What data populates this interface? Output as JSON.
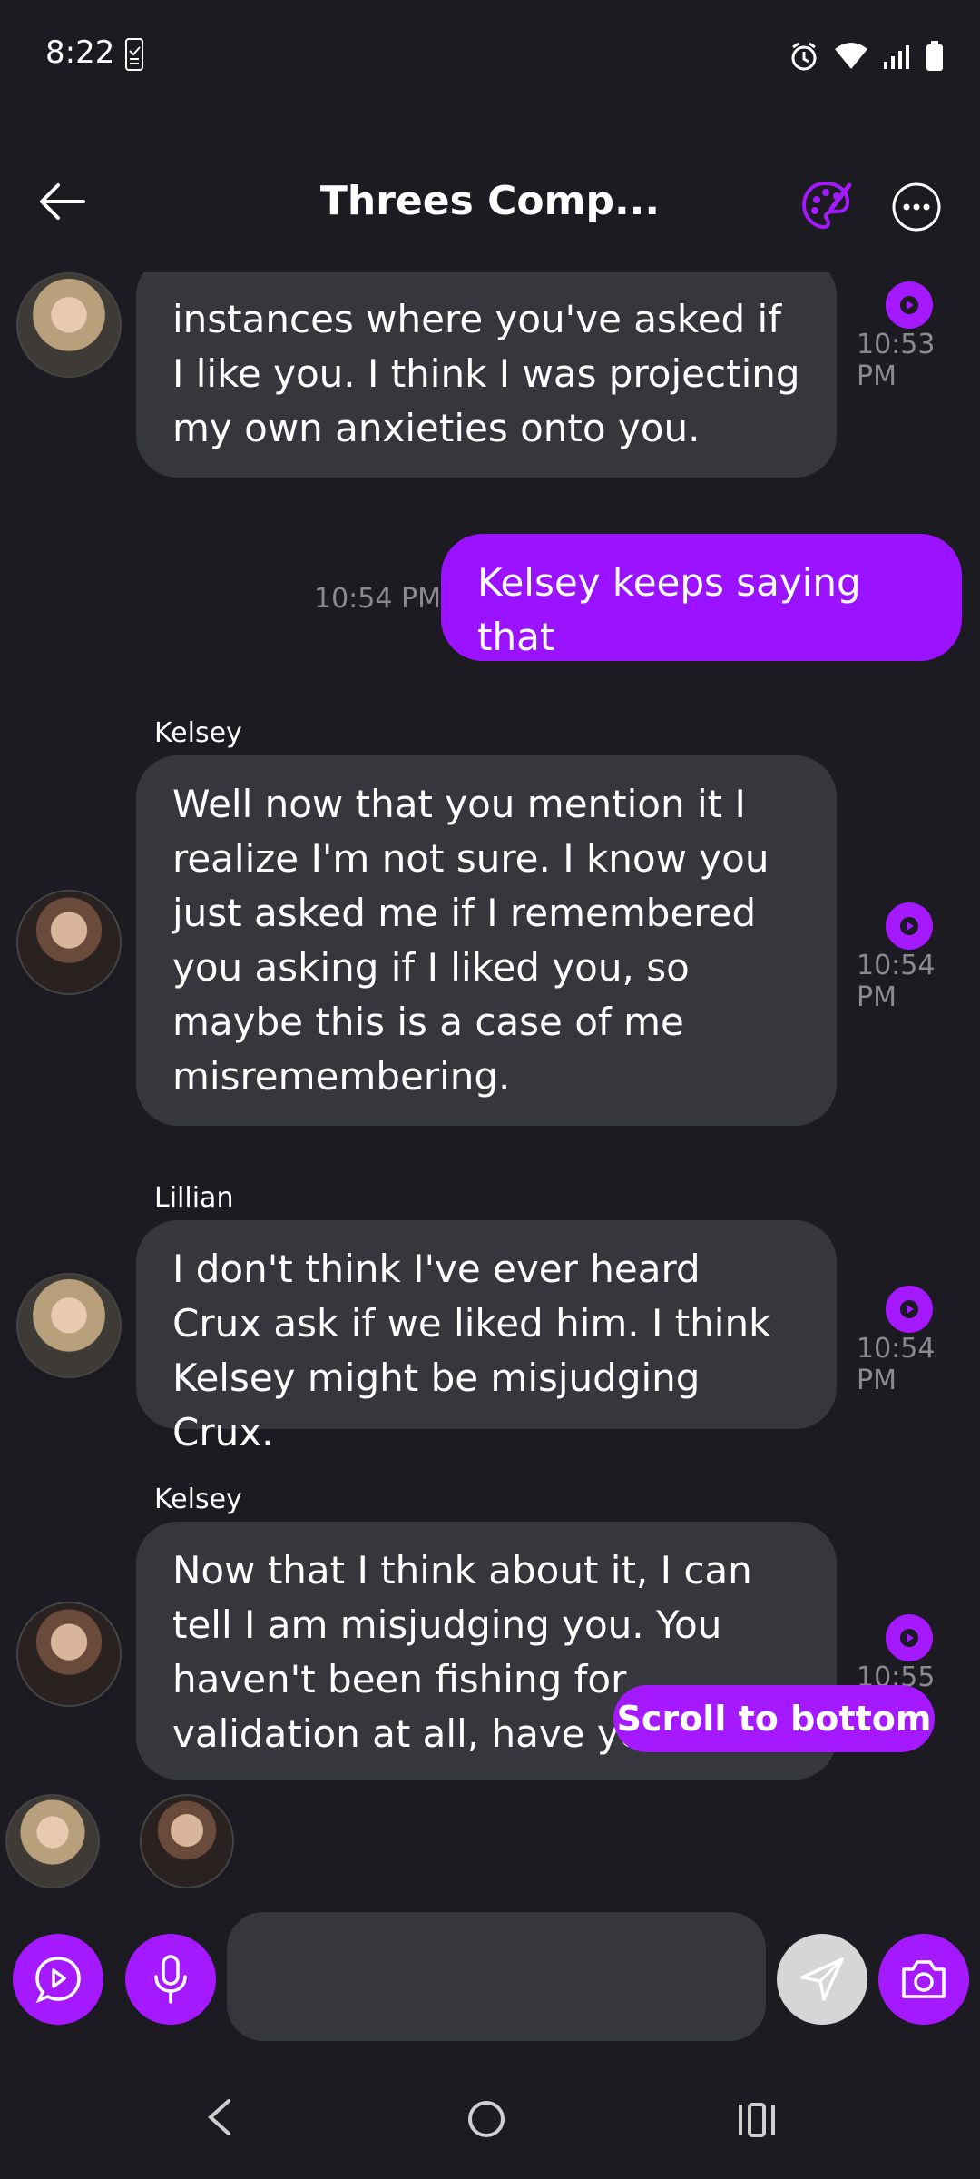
{
  "status_bar": {
    "time": "8:22",
    "icons": [
      "clipboard-check-icon",
      "alarm-icon",
      "wifi-icon",
      "signal-icon",
      "battery-icon"
    ]
  },
  "header": {
    "title": "Threes Comp...",
    "icons": [
      "back-arrow-icon",
      "palette-icon",
      "more-horizontal-icon"
    ],
    "accent_color": "#a419ff"
  },
  "messages": [
    {
      "sender": "",
      "text": "instances where you've asked if I like you. I think I was projecting my own anxieties onto you.",
      "time": "10:53 PM"
    },
    {
      "sender": "me",
      "text": "Kelsey keeps saying that",
      "time": "10:54 PM"
    },
    {
      "sender": "Kelsey",
      "text": "Well now that you mention it I realize I'm not sure. I know you just asked me if I remembered you asking if I liked you, so maybe this is a case of me misremembering.",
      "time": "10:54 PM"
    },
    {
      "sender": "Lillian",
      "text": "I don't think I've ever heard Crux ask if we liked him. I think Kelsey might be misjudging Crux.",
      "time": "10:54 PM"
    },
    {
      "sender": "Kelsey",
      "text": "Now that I think about it, I can tell I am misjudging you. You haven't been fishing for validation at all, have you?",
      "time": "10:55 PM"
    }
  ],
  "scroll_button": "Scroll to bottom",
  "composer": {
    "placeholder": "",
    "buttons": [
      "video-chat-icon",
      "microphone-icon",
      "send-icon",
      "camera-icon"
    ]
  },
  "nav": [
    "nav-back-icon",
    "nav-home-icon",
    "nav-recents-icon"
  ]
}
